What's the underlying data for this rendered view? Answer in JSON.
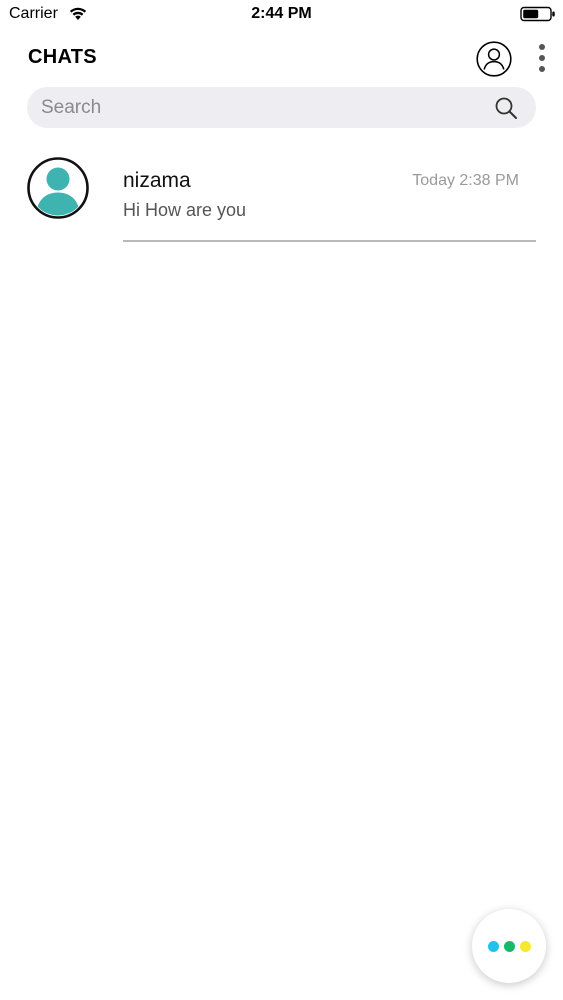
{
  "status_bar": {
    "carrier": "Carrier",
    "time": "2:44 PM",
    "wifi_icon": "wifi-icon",
    "battery_icon": "battery-icon"
  },
  "header": {
    "title": "CHATS",
    "profile_icon": "user-circle-icon",
    "more_icon": "vertical-ellipsis-icon"
  },
  "search": {
    "placeholder": "Search",
    "value": "",
    "icon": "search-icon"
  },
  "chats": [
    {
      "name": "nizama",
      "time": "Today 2:38 PM",
      "last_message": "Hi How are you",
      "avatar_icon": "user-avatar-icon"
    }
  ],
  "fab": {
    "icon": "three-dots-icon",
    "dot_colors": [
      "#1fc3ee",
      "#17b86a",
      "#f6e830"
    ]
  },
  "colors": {
    "avatar_fill": "#3fb3b0",
    "search_background": "#eeedf1",
    "secondary_text": "#9a9a9e"
  }
}
